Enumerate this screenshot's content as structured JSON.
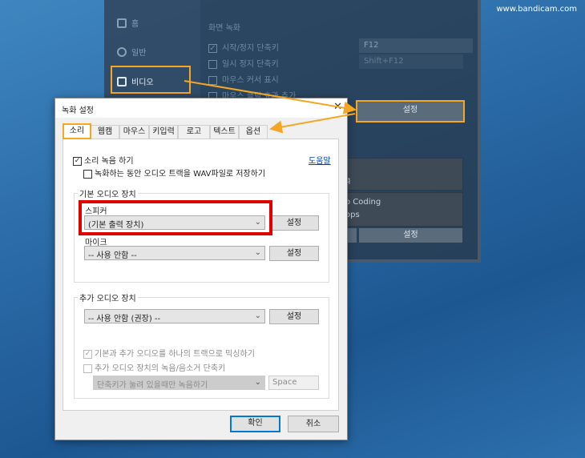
{
  "watermark": "www.bandicam.com",
  "app": {
    "sidebar": [
      {
        "label": "홈",
        "icon": "home-icon"
      },
      {
        "label": "일반",
        "icon": "gear-icon"
      },
      {
        "label": "비디오",
        "icon": "video-settings-icon"
      }
    ],
    "section_title": "화면 녹화",
    "options": [
      {
        "label": "시작/정지 단축키",
        "checked": true
      },
      {
        "label": "일시 정지 단축키",
        "checked": false
      },
      {
        "label": "마우스 커서 표시",
        "checked": false
      },
      {
        "label": "마우스 클릭 효과 추가",
        "checked": false
      }
    ],
    "hotkeys": [
      "F12",
      "Shift+F12"
    ],
    "settings_button": "설정",
    "panel_texts": [
      "q",
      "o Coding",
      "ops"
    ],
    "bottom_settings_button": "설정",
    "accent_color": "#f5a623"
  },
  "dialog": {
    "title": "녹화 설정",
    "tabs": [
      "소리",
      "웹캠",
      "마우스",
      "키입력",
      "로고",
      "텍스트",
      "옵션"
    ],
    "selected_tab": "소리",
    "record_sound": {
      "label": "소리 녹음 하기",
      "checked": true
    },
    "save_wav": {
      "label": "녹화하는 동안 오디오 트랙을 WAV파일로 저장하기",
      "checked": false
    },
    "help_link": "도움말",
    "primary_group": {
      "title": "기본 오디오 장치",
      "speaker_label": "스피커",
      "speaker_value": "(기본 출력 장치)",
      "mic_label": "마이크",
      "mic_value": "-- 사용 안함 --",
      "settings_button": "설정"
    },
    "secondary_group": {
      "title": "추가 오디오 장치",
      "device_value": "-- 사용 안함 (권장) --",
      "settings_button": "설정",
      "mix": {
        "label": "기본과 추가 오디오를 하나의 트랙으로 믹싱하기",
        "checked": true,
        "disabled": true
      },
      "hotkey": {
        "label": "추가 오디오 장치의 녹음/음소거 단축키",
        "checked": false
      },
      "hotkey_mode": "단축키가 눌려 있을때만 녹음하기",
      "hotkey_key": "Space"
    },
    "ok": "확인",
    "cancel": "취소",
    "highlight_color": "#e00000"
  }
}
